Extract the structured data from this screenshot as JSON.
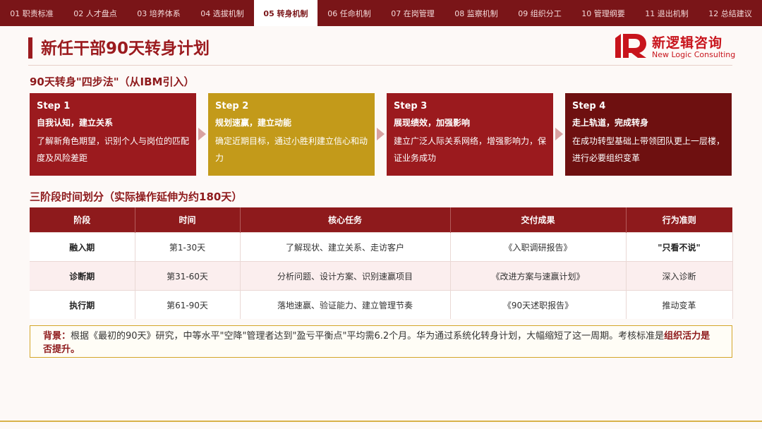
{
  "nav": {
    "tabs": [
      "01 职责标准",
      "02 人才盘点",
      "03 培养体系",
      "04 选拔机制",
      "05 转身机制",
      "06 任命机制",
      "07 在岗管理",
      "08 监察机制",
      "09 组织分工",
      "10 管理纲要",
      "11 退出机制",
      "12 总结建议"
    ],
    "active_index": 4
  },
  "page_title": "新任干部90天转身计划",
  "logo": {
    "cn": "新逻辑咨询",
    "en": "New Logic Consulting"
  },
  "section1_title": "90天转身\"四步法\"（从IBM引入）",
  "steps": [
    {
      "no": "Step 1",
      "head": "自我认知，建立关系",
      "desc": "了解新角色期望，识别个人与岗位的匹配度及风险差距",
      "color": "#9b1a1e"
    },
    {
      "no": "Step 2",
      "head": "规划速赢，建立动能",
      "desc": "确定近期目标，通过小胜利建立信心和动力",
      "color": "#c39a1a"
    },
    {
      "no": "Step 3",
      "head": "展现绩效，加强影响",
      "desc": "建立广泛人际关系网络，增强影响力，保证业务成功",
      "color": "#9b1a1e"
    },
    {
      "no": "Step 4",
      "head": "走上轨道，完成转身",
      "desc": "在成功转型基础上带领团队更上一层楼，进行必要组织变革",
      "color": "#6e1010"
    }
  ],
  "section2_title": "三阶段时间划分（实际操作延伸为约180天）",
  "table": {
    "headers": [
      "阶段",
      "时间",
      "核心任务",
      "交付成果",
      "行为准则"
    ],
    "rows": [
      [
        "融入期",
        "第1-30天",
        "了解现状、建立关系、走访客户",
        "《入职调研报告》",
        "\"只看不说\""
      ],
      [
        "诊断期",
        "第31-60天",
        "分析问题、设计方案、识别速赢项目",
        "《改进方案与速赢计划》",
        "深入诊断"
      ],
      [
        "执行期",
        "第61-90天",
        "落地速赢、验证能力、建立管理节奏",
        "《90天述职报告》",
        "推动变革"
      ]
    ]
  },
  "note": {
    "lead": "背景：",
    "body": "根据《最初的90天》研究，中等水平\"空降\"管理者达到\"盈亏平衡点\"平均需6.2个月。华为通过系统化转身计划，大幅缩短了这一周期。考核标准是",
    "emphasis": "组织活力是否提升。"
  },
  "colors": {
    "primary": "#8e1a1c",
    "gold": "#c39a1a",
    "dark": "#6e1010",
    "logo_red": "#c8141c"
  }
}
